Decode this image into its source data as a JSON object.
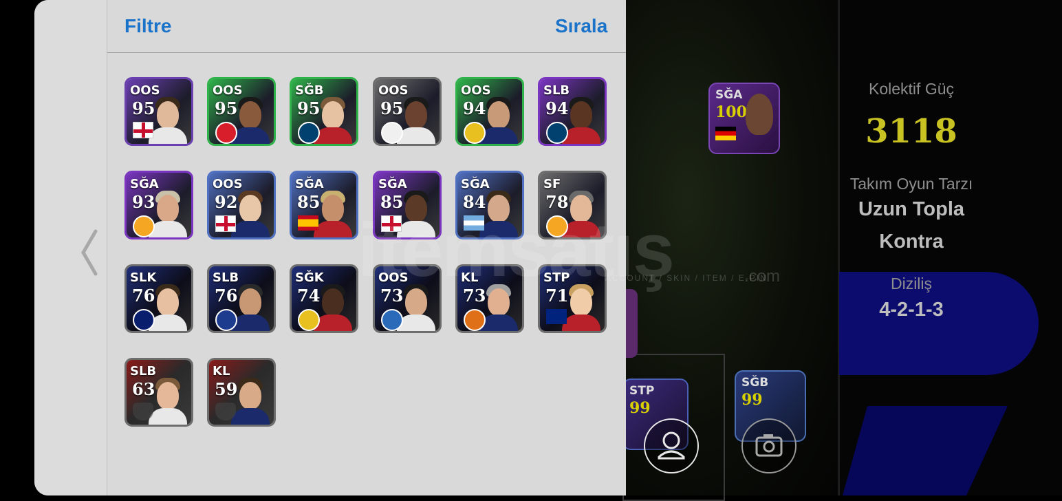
{
  "header": {
    "filter_label": "Filtre",
    "sort_label": "Sırala"
  },
  "players": [
    {
      "pos": "OOS",
      "rating": "95",
      "badge": "flag-england",
      "theme": "#6a3fb0"
    },
    {
      "pos": "OOS",
      "rating": "95",
      "badge": "club-red-crest",
      "theme": "#2fb24a"
    },
    {
      "pos": "SĞB",
      "rating": "95",
      "badge": "club-psg",
      "theme": "#2fb24a"
    },
    {
      "pos": "OOS",
      "rating": "95",
      "badge": "club-white-crest",
      "theme": "#6d6d6d"
    },
    {
      "pos": "OOS",
      "rating": "94",
      "badge": "club-gold-crest",
      "theme": "#2fb24a"
    },
    {
      "pos": "SLB",
      "rating": "94",
      "badge": "club-psg",
      "theme": "#7a35c0"
    },
    {
      "pos": "SĞA",
      "rating": "93",
      "badge": "club-galatasaray",
      "theme": "#7a35c0"
    },
    {
      "pos": "OOS",
      "rating": "92",
      "badge": "flag-england",
      "theme": "#4f6fc0"
    },
    {
      "pos": "SĞA",
      "rating": "85",
      "badge": "flag-spain",
      "theme": "#4f6fc0"
    },
    {
      "pos": "SĞA",
      "rating": "85",
      "badge": "flag-england",
      "theme": "#7a35c0"
    },
    {
      "pos": "SĞA",
      "rating": "84",
      "badge": "flag-argentina",
      "theme": "#4f6fc0"
    },
    {
      "pos": "SF",
      "rating": "78",
      "badge": "club-galatasaray",
      "theme": "#6d6d6d"
    },
    {
      "pos": "SLK",
      "rating": "76",
      "badge": "club-inter",
      "theme": "#6d6d6d"
    },
    {
      "pos": "SLB",
      "rating": "76",
      "badge": "club-blue-crest",
      "theme": "#6d6d6d"
    },
    {
      "pos": "SĞK",
      "rating": "74",
      "badge": "club-gold-crest",
      "theme": "#6d6d6d"
    },
    {
      "pos": "OOS",
      "rating": "73",
      "badge": "club-blue-stripes",
      "theme": "#6d6d6d"
    },
    {
      "pos": "KL",
      "rating": "73",
      "badge": "club-orange-crest",
      "theme": "#6d6d6d"
    },
    {
      "pos": "STP",
      "rating": "71",
      "badge": "flag-australia",
      "theme": "#6d6d6d"
    },
    {
      "pos": "SLB",
      "rating": "63",
      "badge": "shield-placeholder",
      "theme": "#6d6d6d"
    },
    {
      "pos": "KL",
      "rating": "59",
      "badge": "shield-placeholder",
      "theme": "#6d6d6d"
    }
  ],
  "team": {
    "power_label": "Kolektif Güç",
    "power_value": "3118",
    "style_label": "Takım Oyun Tarzı",
    "style_line1": "Uzun Topla",
    "style_line2": "Kontra",
    "formation_label": "Diziliş",
    "formation_value": "4-2-1-3"
  },
  "field_cards": [
    {
      "pos": "SĞA",
      "rating": "100"
    },
    {
      "pos": "STP",
      "rating": "99"
    },
    {
      "pos": "SĞB",
      "rating": "99"
    }
  ],
  "watermark": {
    "text": "itemsatış",
    "subtext": "ACCOUNT / SKIN / ITEM / E-PIN",
    "domain": ".com"
  }
}
